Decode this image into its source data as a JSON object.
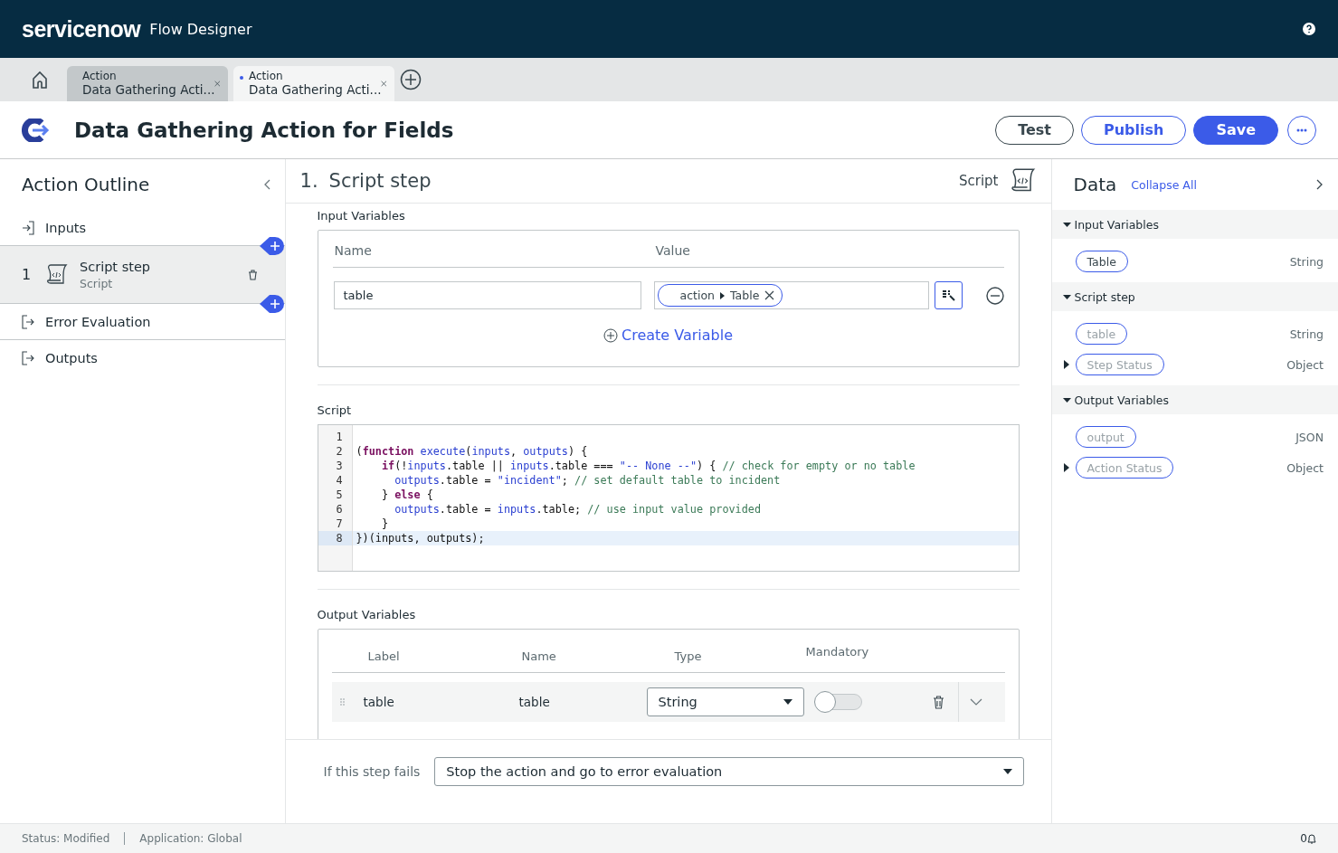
{
  "app_bar": {
    "brand": "servicenow",
    "product": "Flow Designer"
  },
  "tabs": [
    {
      "type_label": "Action",
      "title": "Data Gathering Acti...",
      "selected": false,
      "modified": false
    },
    {
      "type_label": "Action",
      "title": "Data Gathering Acti...",
      "selected": true,
      "modified": true
    }
  ],
  "title": "Data Gathering Action for Fields",
  "buttons": [
    {
      "label": "Test",
      "kind": "outline"
    },
    {
      "label": "Publish",
      "kind": "secondary"
    },
    {
      "label": "Save",
      "kind": "primary"
    }
  ],
  "outline": {
    "title": "Action Outline",
    "items": [
      {
        "kind": "input",
        "label": "Inputs",
        "selected": false
      },
      {
        "kind": "step",
        "number": "1",
        "label": "Script step",
        "sublabel": "Script",
        "selected": true
      },
      {
        "kind": "output",
        "label": "Error Evaluation",
        "selected": false
      },
      {
        "kind": "output",
        "label": "Outputs",
        "selected": false
      }
    ]
  },
  "step": {
    "number": "1.",
    "title": "Script step",
    "type": "Script"
  },
  "input_variables": {
    "title": "Input Variables",
    "columns": [
      "Name",
      "Value"
    ],
    "rows": [
      {
        "name": "table",
        "pill": [
          "action",
          "Table"
        ]
      }
    ],
    "create": "Create Variable"
  },
  "script": {
    "title": "Script",
    "lines": [
      {
        "number": "1",
        "highlighted": false
      },
      {
        "number": "2",
        "highlighted": false,
        "tokens": [
          {
            "kind": "plain",
            "text": "("
          },
          {
            "kind": "keyword",
            "text": "function"
          },
          {
            "kind": "name",
            "text": " execute"
          },
          {
            "kind": "plain",
            "text": "("
          },
          {
            "kind": "name",
            "text": "inputs"
          },
          {
            "kind": "plain",
            "text": ", "
          },
          {
            "kind": "name",
            "text": "outputs"
          },
          {
            "kind": "plain",
            "text": ") {"
          }
        ]
      },
      {
        "number": "3",
        "highlighted": false,
        "tokens": [
          {
            "kind": "keyword",
            "text": "    if"
          },
          {
            "kind": "plain",
            "text": "(!"
          },
          {
            "kind": "name",
            "text": "inputs"
          },
          {
            "kind": "plain",
            "text": ".table || "
          },
          {
            "kind": "name",
            "text": "inputs"
          },
          {
            "kind": "plain",
            "text": ".table === "
          },
          {
            "kind": "string",
            "text": "\"-- None --\""
          },
          {
            "kind": "plain",
            "text": ") { "
          },
          {
            "kind": "comment",
            "text": "// check for empty or no table"
          }
        ]
      },
      {
        "number": "4",
        "highlighted": false,
        "tokens": [
          {
            "kind": "name",
            "text": "      outputs"
          },
          {
            "kind": "plain",
            "text": ".table = "
          },
          {
            "kind": "string",
            "text": "\"incident\""
          },
          {
            "kind": "plain",
            "text": "; "
          },
          {
            "kind": "comment",
            "text": "// set default table to incident"
          }
        ]
      },
      {
        "number": "5",
        "highlighted": false,
        "tokens": [
          {
            "kind": "plain",
            "text": "    } "
          },
          {
            "kind": "keyword",
            "text": "else"
          },
          {
            "kind": "plain",
            "text": " {"
          }
        ]
      },
      {
        "number": "6",
        "highlighted": false,
        "tokens": [
          {
            "kind": "name",
            "text": "      outputs"
          },
          {
            "kind": "plain",
            "text": ".table = "
          },
          {
            "kind": "name",
            "text": "inputs"
          },
          {
            "kind": "plain",
            "text": ".table; "
          },
          {
            "kind": "comment",
            "text": "// use input value provided"
          }
        ]
      },
      {
        "number": "7",
        "highlighted": false,
        "tokens": [
          {
            "kind": "plain",
            "text": "    }"
          }
        ]
      },
      {
        "number": "8",
        "highlighted": true,
        "tokens": [
          {
            "kind": "plain",
            "text": "})(inputs, outputs);"
          }
        ]
      }
    ]
  },
  "output_variables": {
    "title": "Output Variables",
    "columns": [
      "Label",
      "Name",
      "Type",
      "Mandatory"
    ],
    "rows": [
      {
        "label": "table",
        "name": "table",
        "type": "String",
        "mandatory": false
      }
    ]
  },
  "failure": {
    "label": "If this step fails",
    "value": "Stop the action and go to error evaluation"
  },
  "data_panel": {
    "title": "Data",
    "action": "Collapse All",
    "sections": [
      {
        "title": "Input Variables",
        "expanded": true,
        "items": [
          {
            "label": "Table",
            "type": "String",
            "active": true,
            "expandable": false
          }
        ]
      },
      {
        "title": "Script step",
        "expanded": true,
        "items": [
          {
            "label": "table",
            "type": "String",
            "active": false,
            "expandable": false
          },
          {
            "label": "Step Status",
            "type": "Object",
            "active": false,
            "expandable": true
          }
        ]
      },
      {
        "title": "Output Variables",
        "expanded": true,
        "items": [
          {
            "label": "output",
            "type": "JSON",
            "active": false,
            "expandable": false
          },
          {
            "label": "Action Status",
            "type": "Object",
            "active": false,
            "expandable": true
          }
        ]
      }
    ]
  },
  "status_bar": {
    "items": [
      "Status: Modified",
      "Application: Global"
    ],
    "notifications": "0"
  }
}
